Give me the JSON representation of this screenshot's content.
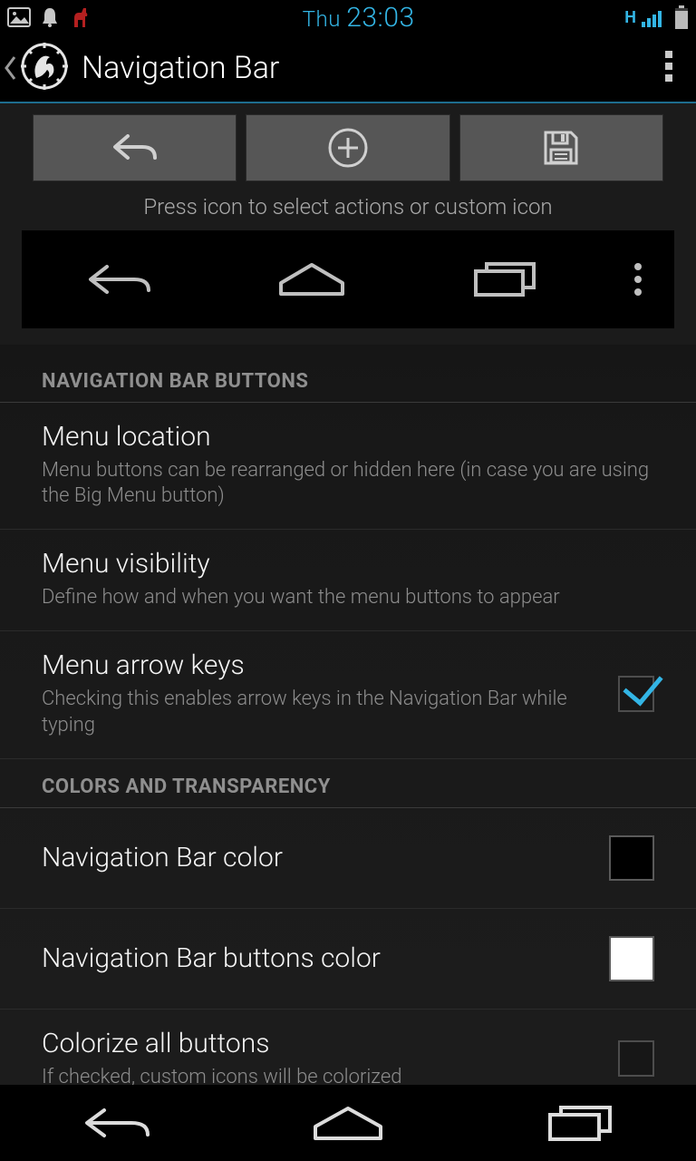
{
  "status": {
    "day": "Thu",
    "time": "23:03",
    "network": "H"
  },
  "actionbar": {
    "title": "Navigation Bar"
  },
  "toolbar": {
    "buttons": [
      "undo",
      "add",
      "save"
    ],
    "hint": "Press icon to select actions or custom icon"
  },
  "preview": {
    "buttons": [
      "back",
      "home",
      "recent",
      "menu"
    ]
  },
  "sections": [
    {
      "header": "Navigation Bar Buttons",
      "items": [
        {
          "key": "menu-location",
          "title": "Menu location",
          "sub": "Menu buttons can be rearranged or hidden here (in case you are using the Big Menu button)",
          "widget": null
        },
        {
          "key": "menu-visibility",
          "title": "Menu visibility",
          "sub": "Define how and when you want the menu buttons to appear",
          "widget": null
        },
        {
          "key": "menu-arrow-keys",
          "title": "Menu arrow keys",
          "sub": "Checking this enables arrow keys in the Navigation Bar while typing",
          "widget": {
            "type": "checkbox",
            "checked": true
          }
        }
      ]
    },
    {
      "header": "Colors and Transparency",
      "items": [
        {
          "key": "navbar-color",
          "title": "Navigation Bar color",
          "sub": "",
          "widget": {
            "type": "swatch",
            "color": "#000000"
          }
        },
        {
          "key": "navbar-buttons-color",
          "title": "Navigation Bar buttons color",
          "sub": "",
          "widget": {
            "type": "swatch",
            "color": "#ffffff"
          }
        },
        {
          "key": "colorize-all",
          "title": "Colorize all buttons",
          "sub": "If checked, custom icons will be colorized",
          "widget": {
            "type": "checkbox",
            "checked": false
          }
        }
      ]
    }
  ],
  "sysnav": {
    "buttons": [
      "back",
      "home",
      "recent"
    ]
  }
}
